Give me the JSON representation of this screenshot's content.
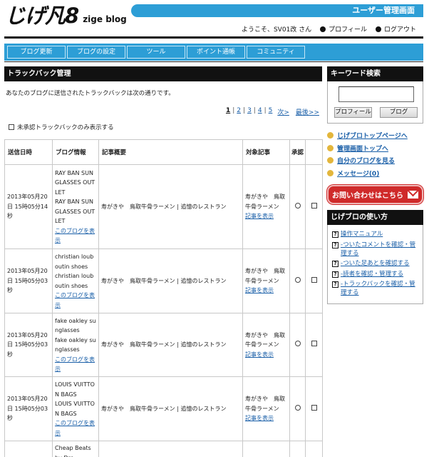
{
  "header": {
    "logo_jp": "じげ凡8",
    "logo_en": "zige blog",
    "admin_title": "ユーザー管理画面",
    "welcome": "ようこそ、SV01改 さん",
    "profile_link": "プロフィール",
    "logout_link": "ログアウト"
  },
  "nav": {
    "tabs": [
      "ブログ更新",
      "ブログの設定",
      "ツール",
      "ポイント通帳",
      "コミュニティ"
    ]
  },
  "main": {
    "title": "トラックバック管理",
    "intro": "あなたのブログに送信されたトラックバックは次の通りです。",
    "pager": {
      "pages": [
        "1",
        "2",
        "3",
        "4",
        "5"
      ],
      "current": "1",
      "next": "次>",
      "last": "最後>>"
    },
    "filter_label": "未承認トラックバックのみ表示する",
    "columns": {
      "date": "送信日時",
      "info": "ブログ情報",
      "summary": "記事概要",
      "target": "対象記事",
      "approve": "承認"
    },
    "rows": [
      {
        "date": "2013年05月20日 15時05分14秒",
        "blog_name": "RAY BAN SUNGLASSES OUTLET",
        "blog_name2": "RAY BAN SUNGLASSES OUTLET",
        "blog_link": "このブログを表示",
        "summary": "寿がきや　鳥取牛骨ラーメン | 追憶のレストラン",
        "target": "寿がきや　鳥取牛骨ラーメン",
        "target_link": "記事を表示"
      },
      {
        "date": "2013年05月20日 15時05分03秒",
        "blog_name": "christian louboutin shoes",
        "blog_name2": "christian louboutin shoes",
        "blog_link": "このブログを表示",
        "summary": "寿がきや　鳥取牛骨ラーメン | 追憶のレストラン",
        "target": "寿がきや　鳥取牛骨ラーメン",
        "target_link": "記事を表示"
      },
      {
        "date": "2013年05月20日 15時05分03秒",
        "blog_name": "fake oakley sunglasses",
        "blog_name2": "fake oakley sunglasses",
        "blog_link": "このブログを表示",
        "summary": "寿がきや　鳥取牛骨ラーメン | 追憶のレストラン",
        "target": "寿がきや　鳥取牛骨ラーメン",
        "target_link": "記事を表示"
      },
      {
        "date": "2013年05月20日 15時05分03秒",
        "blog_name": "LOUIS VUITTON BAGS",
        "blog_name2": "LOUIS VUITTON BAGS",
        "blog_link": "このブログを表示",
        "summary": "寿がきや　鳥取牛骨ラーメン | 追憶のレストラン",
        "target": "寿がきや　鳥取牛骨ラーメン",
        "target_link": "記事を表示"
      },
      {
        "date": "",
        "blog_name": "Cheap Beats by Dre",
        "blog_name2": "",
        "blog_link": "",
        "summary": "",
        "target": "",
        "target_link": ""
      }
    ]
  },
  "sidebar": {
    "keyword_title": "キーワード検索",
    "profile_btn": "プロフィール",
    "blog_btn": "ブログ",
    "links": [
      "じげブロトップページへ",
      "管理画面トップへ",
      "自分のブログを見る",
      "メッセージ(0)"
    ],
    "contact": "お問い合わせはこちら",
    "howto_title": "じげブロの使い方",
    "howto": [
      "操作マニュアル",
      "-ついたコメントを確認・管理する",
      "-ついた足あとを確認する",
      "-読者を確認・管理する",
      "-トラックバックを確認・管理する"
    ]
  }
}
